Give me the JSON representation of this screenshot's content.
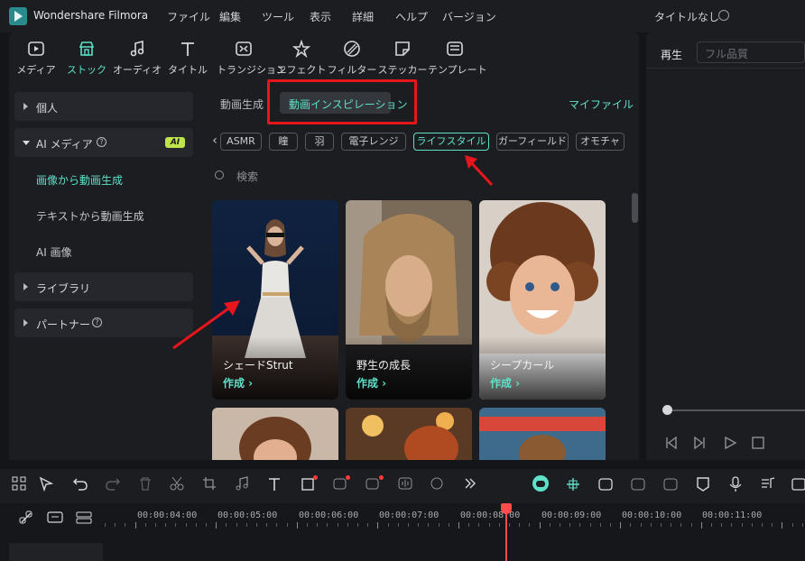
{
  "app": {
    "title": "Wondershare Filmora",
    "project_title": "タイトルなし"
  },
  "menu": [
    "ファイル",
    "編集",
    "ツール",
    "表示",
    "詳細",
    "ヘルプ",
    "バージョン"
  ],
  "toolbar": {
    "tabs": [
      {
        "label": "メディア",
        "icon": "media-icon"
      },
      {
        "label": "ストック",
        "icon": "stock-icon",
        "active": true
      },
      {
        "label": "オーディオ",
        "icon": "audio-icon"
      },
      {
        "label": "タイトル",
        "icon": "title-icon"
      },
      {
        "label": "トランジション",
        "icon": "transition-icon"
      },
      {
        "label": "エフェクト",
        "icon": "effect-icon"
      },
      {
        "label": "フィルター",
        "icon": "filter-icon"
      },
      {
        "label": "ステッカー",
        "icon": "sticker-icon"
      },
      {
        "label": "テンプレート",
        "icon": "template-icon"
      }
    ]
  },
  "sidebar": {
    "items": [
      {
        "label": "個人"
      },
      {
        "label": "AI メディア",
        "badge": "AI"
      },
      {
        "label": "ライブラリ"
      },
      {
        "label": "パートナー"
      }
    ],
    "sub_items": [
      "画像から動画生成",
      "テキストから動画生成",
      "AI 画像"
    ]
  },
  "content": {
    "tab_generate": "動画生成",
    "tab_inspiration": "動画インスピレーション",
    "my_files": "マイファイル",
    "chips": [
      "ASMR",
      "瞳",
      "羽",
      "電子レンジ",
      "ライフスタイル",
      "ガーフィールド",
      "オモチャ"
    ],
    "active_chip": "ライフスタイル",
    "search_placeholder": "検索",
    "cards": [
      {
        "title": "シェードStrut",
        "action": "作成 ›"
      },
      {
        "title": "野生の成長",
        "action": "作成 ›"
      },
      {
        "title": "シープカール",
        "action": "作成 ›"
      }
    ]
  },
  "preview": {
    "play_label": "再生",
    "quality": "フル品質"
  },
  "timeline": {
    "times": [
      "00:00:04:00",
      "00:00:05:00",
      "00:00:06:00",
      "00:00:07:00",
      "00:00:08:00",
      "00:00:09:00",
      "00:00:10:00",
      "00:00:11:00"
    ]
  },
  "colors": {
    "accent": "#5fe0c8",
    "highlight_box": "#e7161d",
    "playhead": "#ff4d4d",
    "ai_badge": "#bfe34a"
  }
}
